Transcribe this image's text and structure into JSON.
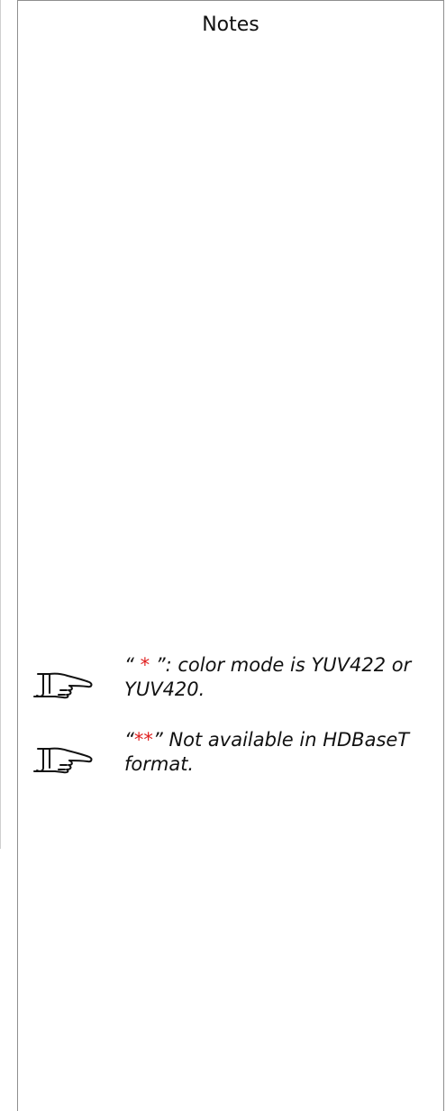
{
  "header": {
    "title": "Notes"
  },
  "notes": [
    {
      "icon": "pointing-hand-icon",
      "open_quote": "“ ",
      "marker": "*",
      "close_quote": " ”",
      "rest": ": color mode is YUV422 or YUV420."
    },
    {
      "icon": "pointing-hand-icon",
      "open_quote": "“",
      "marker": "**",
      "close_quote": "”",
      "rest": " Not available in HDBaseT format."
    }
  ],
  "colors": {
    "marker": "#e02020",
    "border": "#8f8f8f",
    "text": "#111111"
  }
}
